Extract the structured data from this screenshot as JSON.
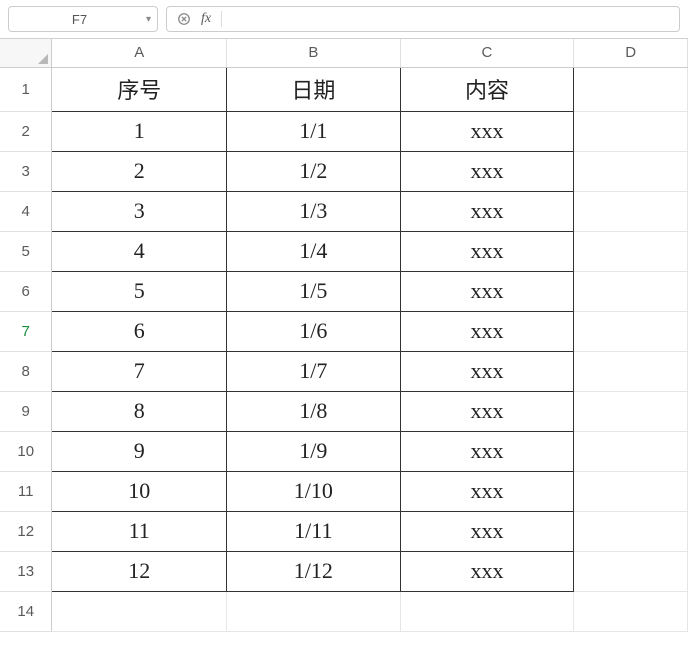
{
  "toolbar": {
    "cell_reference": "F7",
    "formula_value": ""
  },
  "columns": [
    "A",
    "B",
    "C",
    "D"
  ],
  "row_headers": [
    "1",
    "2",
    "3",
    "4",
    "5",
    "6",
    "7",
    "8",
    "9",
    "10",
    "11",
    "12",
    "13",
    "14"
  ],
  "selected_row_header": "7",
  "header_row": {
    "A": "序号",
    "B": "日期",
    "C": "内容"
  },
  "data_rows": [
    {
      "A": "1",
      "B": "1/1",
      "C": "xxx"
    },
    {
      "A": "2",
      "B": "1/2",
      "C": "xxx"
    },
    {
      "A": "3",
      "B": "1/3",
      "C": "xxx"
    },
    {
      "A": "4",
      "B": "1/4",
      "C": "xxx"
    },
    {
      "A": "5",
      "B": "1/5",
      "C": "xxx"
    },
    {
      "A": "6",
      "B": "1/6",
      "C": "xxx"
    },
    {
      "A": "7",
      "B": "1/7",
      "C": "xxx"
    },
    {
      "A": "8",
      "B": "1/8",
      "C": "xxx"
    },
    {
      "A": "9",
      "B": "1/9",
      "C": "xxx"
    },
    {
      "A": "10",
      "B": "1/10",
      "C": "xxx"
    },
    {
      "A": "11",
      "B": "1/11",
      "C": "xxx"
    },
    {
      "A": "12",
      "B": "1/12",
      "C": "xxx"
    }
  ],
  "empty_trailing_rows": 1
}
